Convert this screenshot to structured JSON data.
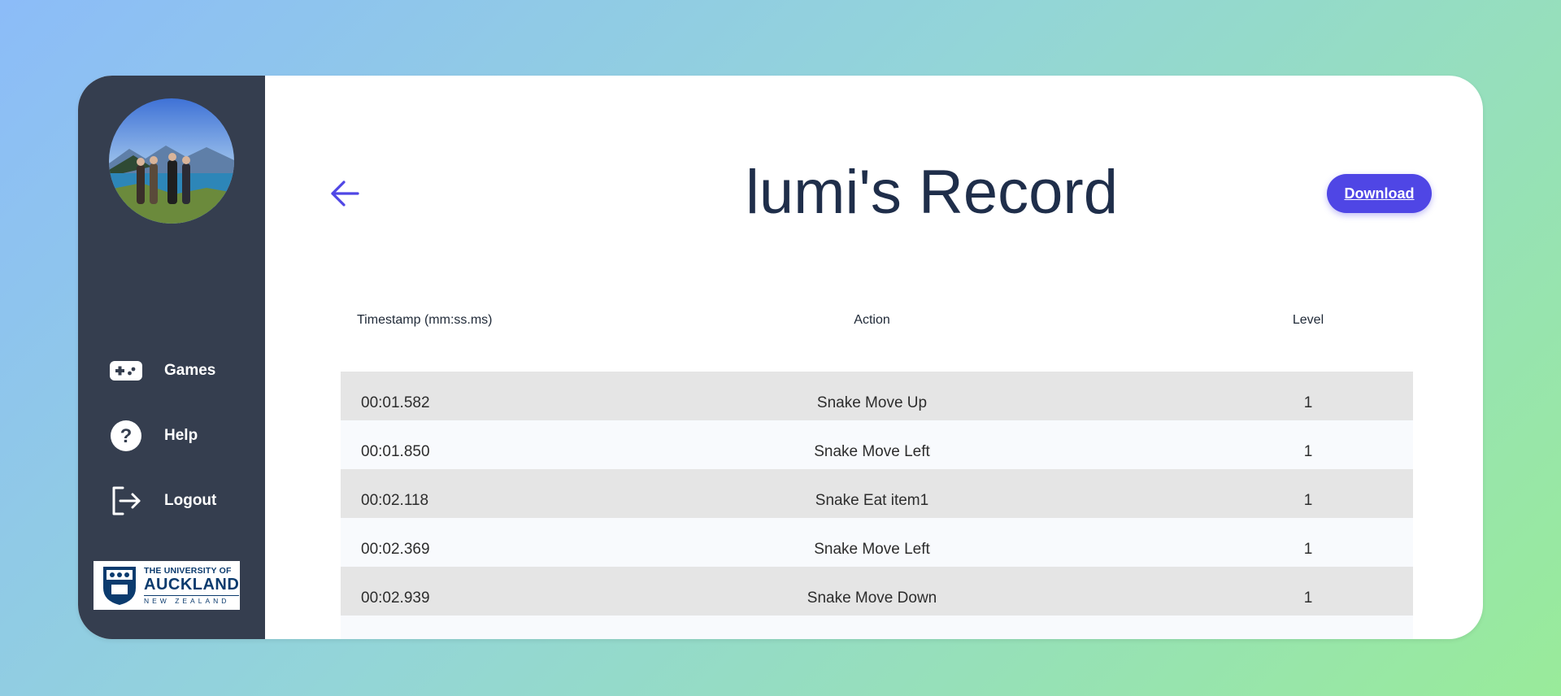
{
  "sidebar": {
    "nav": [
      {
        "label": "Games",
        "icon": "gamepad-icon"
      },
      {
        "label": "Help",
        "icon": "help-circle-icon"
      },
      {
        "label": "Logout",
        "icon": "logout-icon"
      }
    ],
    "logo": {
      "line1": "THE UNIVERSITY OF",
      "line2": "AUCKLAND",
      "line3": "NEW ZEALAND"
    }
  },
  "header": {
    "title": "lumi's Record",
    "download_label": "Download"
  },
  "table": {
    "columns": [
      "Timestamp (mm:ss.ms)",
      "Action",
      "Level"
    ],
    "rows": [
      {
        "timestamp": "00:01.582",
        "action": "Snake Move Up",
        "level": "1"
      },
      {
        "timestamp": "00:01.850",
        "action": "Snake Move Left",
        "level": "1"
      },
      {
        "timestamp": "00:02.118",
        "action": "Snake Eat item1",
        "level": "1"
      },
      {
        "timestamp": "00:02.369",
        "action": "Snake Move Left",
        "level": "1"
      },
      {
        "timestamp": "00:02.939",
        "action": "Snake Move Down",
        "level": "1"
      }
    ]
  },
  "colors": {
    "sidebar_bg": "#353e4f",
    "accent": "#4f46e5",
    "title": "#1f2e4a",
    "row_even": "#e5e5e5",
    "row_odd": "#f8fafd"
  }
}
